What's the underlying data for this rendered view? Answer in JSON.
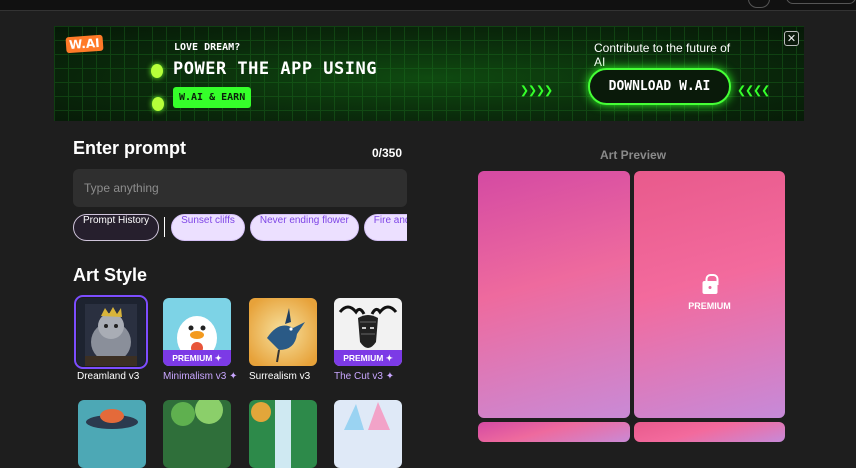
{
  "banner": {
    "logo": "W.AI",
    "tagline": "LOVE DREAM?",
    "headline": "POWER THE APP USING",
    "earn_button": "W.AI & EARN",
    "contribute": "Contribute to the future of AI",
    "download_button": "DOWNLOAD W.AI",
    "close": "✕",
    "arrows_left": "❯❯❯❯",
    "arrows_right": "❮❮❮❮",
    "accent": "#35ff2a"
  },
  "prompt": {
    "heading": "Enter prompt",
    "counter": "0/350",
    "placeholder": "Type anything",
    "value": "",
    "history_label": "Prompt History",
    "suggestions": [
      "Sunset cliffs",
      "Never ending flower",
      "Fire and w"
    ]
  },
  "art_style": {
    "heading": "Art Style",
    "styles": [
      {
        "label": "Dreamland v3",
        "premium": false,
        "selected": true,
        "icon": "cat-king-thumbnail"
      },
      {
        "label": "Minimalism v3 ✦",
        "premium": true,
        "badge": "PREMIUM ✦",
        "icon": "duck-thumbnail"
      },
      {
        "label": "Surrealism v3",
        "premium": false,
        "icon": "bird-thumbnail"
      },
      {
        "label": "The Cut v3 ✦",
        "premium": true,
        "badge": "PREMIUM ✦",
        "icon": "moose-thumbnail"
      }
    ]
  },
  "preview": {
    "title": "Art Preview",
    "premium_label": "PREMIUM",
    "accent": "#7c3ae6"
  }
}
